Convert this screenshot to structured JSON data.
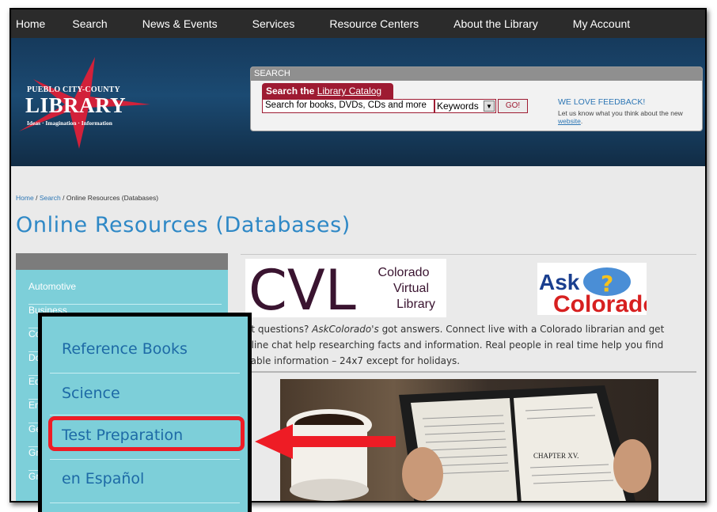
{
  "nav": {
    "items": [
      "Home",
      "Search",
      "News & Events",
      "Services",
      "Resource Centers",
      "About the Library",
      "My Account"
    ]
  },
  "logo": {
    "line1": "PUEBLO CITY-COUNTY",
    "line2": "LIBRARY",
    "line3": "Ideas · Imagination · Information"
  },
  "search": {
    "panel_title": "SEARCH",
    "catalog_prefix": "Search the ",
    "catalog_link": "Library Catalog",
    "input_value": "Search for books, DVDs, CDs and more",
    "select_value": "Keywords",
    "go_label": "GO!"
  },
  "feedback": {
    "title": "WE LOVE FEEDBACK!",
    "text": "Let us know what you think about the new ",
    "link": "website",
    "end": "."
  },
  "breadcrumb": {
    "home": "Home",
    "sep1": "/",
    "search": "Search",
    "sep2": "/",
    "current": "Online Resources (Databases)"
  },
  "page_title": "Online Resources (Databases)",
  "sidebar": {
    "items": [
      "Automotive",
      "Business",
      "Col",
      "Do",
      "Edu",
      "Emp",
      "Gen",
      "Gra",
      "Gra"
    ]
  },
  "cvl": {
    "mark": "CVL",
    "line1": "Colorado",
    "line2": "Virtual",
    "line3": "Library"
  },
  "ask": {
    "line1": "Ask",
    "line2": "Colorado"
  },
  "description": {
    "part1": "ot questions? ",
    "italic": "AskColorado's",
    "part2": " got answers. Connect live with a Colorado librarian and get",
    "line2": "nline chat help researching facts and information. Real people in real time help you find",
    "line3": "liable information – 24x7 except for holidays."
  },
  "book_page": {
    "chapter": "CHAPTER XV."
  },
  "callout": {
    "items": [
      "Reference Books",
      "Science",
      "Test Preparation",
      "en Español"
    ]
  },
  "colors": {
    "accent_red": "#ee1c25",
    "catalog_red": "#9e1b32",
    "link_blue": "#2e77b5",
    "sidebar_teal": "#7dcfd9",
    "title_blue": "#2e88c6"
  }
}
